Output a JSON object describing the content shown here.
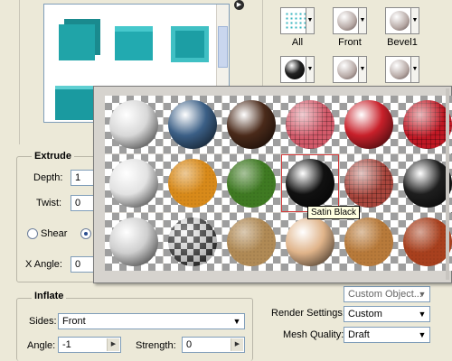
{
  "presets": {
    "mini_labels": [
      "All",
      "Front",
      "Bevel1"
    ]
  },
  "extrude": {
    "title": "Extrude",
    "depth_label": "Depth:",
    "depth_value": "1",
    "twist_label": "Twist:",
    "twist_value": "0",
    "shear_label": "Shear",
    "x_angle_label": "X Angle:",
    "x_angle_value": "0"
  },
  "inflate": {
    "title": "Inflate",
    "sides_label": "Sides:",
    "sides_value": "Front",
    "angle_label": "Angle:",
    "angle_value": "-1",
    "strength_label": "Strength:",
    "strength_value": "0"
  },
  "render": {
    "view_value": "Custom Object...",
    "render_settings_label": "Render Settings:",
    "render_settings_value": "Custom",
    "mesh_quality_label": "Mesh Quality:",
    "mesh_quality_value": "Draft"
  },
  "materials": {
    "tooltip": "Satin Black",
    "tiles": [
      {
        "name": "white-plaster",
        "color": "#d8d8d8"
      },
      {
        "name": "blue-matte",
        "color": "#3b5f86"
      },
      {
        "name": "dark-wood",
        "color": "#4a2a1a"
      },
      {
        "name": "red-mesh",
        "color": "#d35a6a"
      },
      {
        "name": "red-brick-dots",
        "color": "#c8202a"
      },
      {
        "name": "red-grid",
        "color": "#c01824"
      },
      {
        "name": "white-satin",
        "color": "#e2e2e2"
      },
      {
        "name": "orange-stucco",
        "color": "#d88a1a"
      },
      {
        "name": "green-grass",
        "color": "#3f7a22"
      },
      {
        "name": "satin-black",
        "color": "#111111"
      },
      {
        "name": "brick",
        "color": "#a8453c"
      },
      {
        "name": "black-leather",
        "color": "#1e1e1e"
      },
      {
        "name": "white-marble",
        "color": "#cfcfcf"
      },
      {
        "name": "checker",
        "color": "#8a8a8a"
      },
      {
        "name": "sand-rock",
        "color": "#b08a55"
      },
      {
        "name": "skin",
        "color": "#e0b48a"
      },
      {
        "name": "cork",
        "color": "#b87a3a"
      },
      {
        "name": "rust",
        "color": "#a8401e"
      }
    ]
  }
}
